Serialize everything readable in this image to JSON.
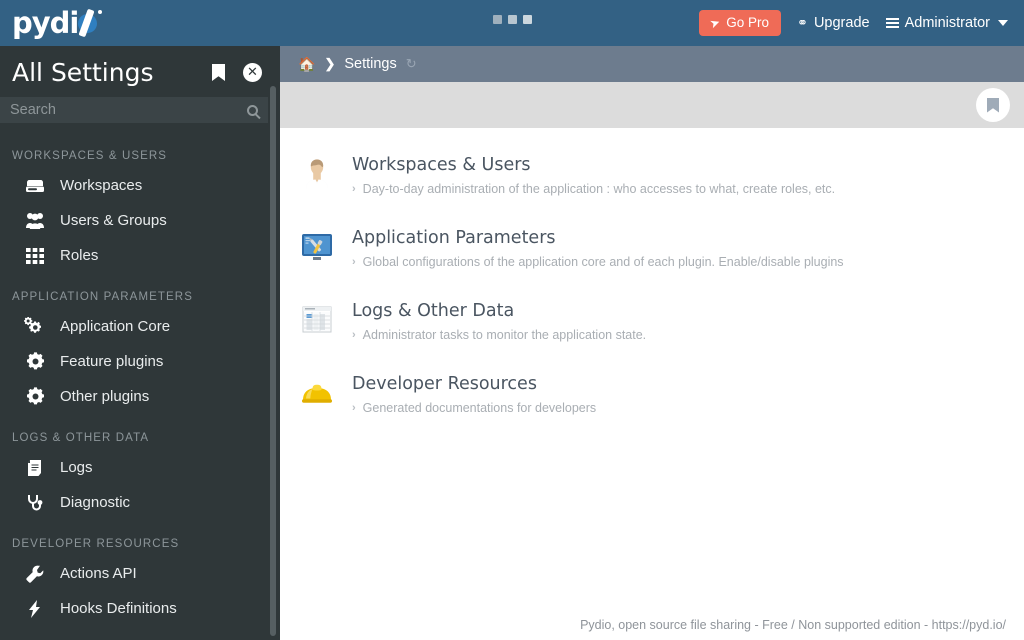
{
  "topbar": {
    "logo_text": "pydi",
    "logo_mark_icon": "pydio-slash-logo",
    "center_dots_icon": "window-dots",
    "go_pro_label": "Go Pro",
    "go_pro_icon": "rocket-icon",
    "go_pro_color": "#ef6b57",
    "upgrade_label": "Upgrade",
    "upgrade_icon": "lightbulb-icon",
    "admin_label": "Administrator",
    "admin_icon": "hamburger-icon",
    "admin_caret_icon": "chevron-down-icon",
    "background_color": "#336184"
  },
  "sidebar": {
    "title": "All Settings",
    "bookmark_icon": "bookmark-icon",
    "close_icon": "close-circle-icon",
    "search": {
      "placeholder": "Search",
      "value": "",
      "icon": "search-icon"
    },
    "background_color": "#2f3739",
    "groups": [
      {
        "label": "WORKSPACES & USERS",
        "items": [
          {
            "label": "Workspaces",
            "icon": "drive-icon"
          },
          {
            "label": "Users & Groups",
            "icon": "users-group-icon"
          },
          {
            "label": "Roles",
            "icon": "grid-icon"
          }
        ]
      },
      {
        "label": "APPLICATION PARAMETERS",
        "items": [
          {
            "label": "Application Core",
            "icon": "gears-icon"
          },
          {
            "label": "Feature plugins",
            "icon": "gear-icon"
          },
          {
            "label": "Other plugins",
            "icon": "gear-icon"
          }
        ]
      },
      {
        "label": "LOGS & OTHER DATA",
        "items": [
          {
            "label": "Logs",
            "icon": "book-icon"
          },
          {
            "label": "Diagnostic",
            "icon": "stethoscope-icon"
          }
        ]
      },
      {
        "label": "DEVELOPER RESOURCES",
        "items": [
          {
            "label": "Actions API",
            "icon": "wrench-icon"
          },
          {
            "label": "Hooks Definitions",
            "icon": "bolt-icon"
          }
        ]
      }
    ]
  },
  "main": {
    "breadcrumb": {
      "home_icon": "home-icon",
      "separator": "❯",
      "label": "Settings",
      "refresh_icon": "refresh-icon"
    },
    "toolbar": {
      "bookmark_icon": "bookmark-icon"
    },
    "cards": [
      {
        "title": "Workspaces & Users",
        "description": "Day-to-day administration of the application : who accesses to what, create roles, etc.",
        "icon": "user-avatar-icon",
        "chevron": "›"
      },
      {
        "title": "Application Parameters",
        "description": "Global configurations of the application core and of each plugin. Enable/disable plugins",
        "icon": "screen-tools-icon",
        "chevron": "›"
      },
      {
        "title": "Logs & Other Data",
        "description": "Administrator tasks to monitor the application state.",
        "icon": "spreadsheet-icon",
        "chevron": "›"
      },
      {
        "title": "Developer Resources",
        "description": "Generated documentations for developers",
        "icon": "hardhat-icon",
        "chevron": "›"
      }
    ],
    "footer": "Pydio, open source file sharing - Free / Non supported edition - https://pyd.io/"
  }
}
